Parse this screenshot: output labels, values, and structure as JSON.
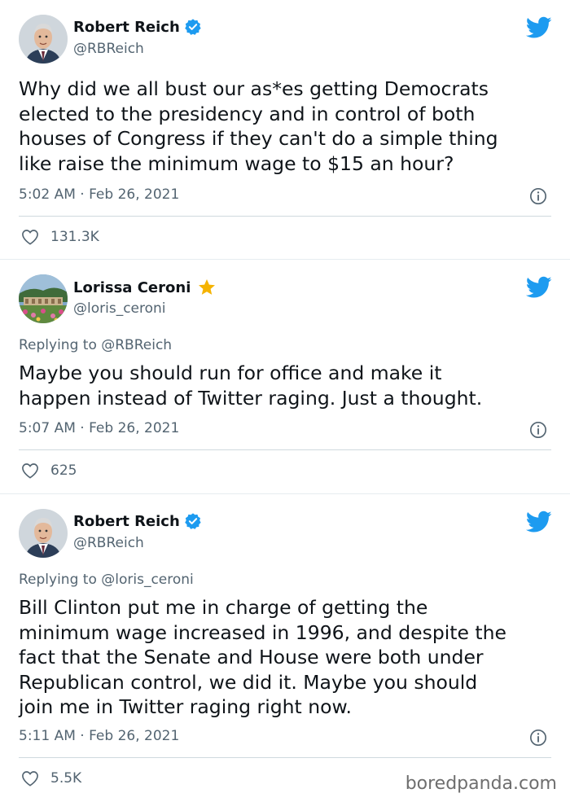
{
  "tweets": [
    {
      "name": "Robert Reich",
      "handle": "@RBReich",
      "replying": "",
      "text_lines": [
        "Why did we all bust our as*es getting Democrats",
        "elected to the presidency and in control of both",
        "houses of Congress if they can't do a simple thing",
        "like raise the minimum wage to $15 an hour?"
      ],
      "timestamp": "5:02 AM · Feb 26, 2021",
      "likes": "131.3K",
      "badge": "verified-icon"
    },
    {
      "name": "Lorissa Ceroni",
      "handle": "@loris_ceroni",
      "replying": "Replying to @RBReich",
      "text_lines": [
        "Maybe you should run for office and make it",
        "happen instead of Twitter raging. Just a thought."
      ],
      "timestamp": "5:07 AM · Feb 26, 2021",
      "likes": "625",
      "badge": "star-icon"
    },
    {
      "name": "Robert Reich",
      "handle": "@RBReich",
      "replying": "Replying to @loris_ceroni",
      "text_lines": [
        "Bill Clinton put me in charge of getting the",
        "minimum wage increased in 1996, and despite the",
        "fact that the Senate and House were both under",
        "Republican control, we did it. Maybe you should",
        "join me in Twitter raging right now."
      ],
      "timestamp": "5:11 AM · Feb 26, 2021",
      "likes": "5.5K",
      "badge": "verified-icon"
    }
  ],
  "watermark": "boredpanda.com",
  "colors": {
    "twitter_blue": "#1d9bf0",
    "text": "#0f1419",
    "secondary": "#536471",
    "star": "#f5b301"
  },
  "icons": [
    "twitter-bird-icon",
    "verified-icon",
    "star-icon",
    "info-icon",
    "heart-icon"
  ]
}
